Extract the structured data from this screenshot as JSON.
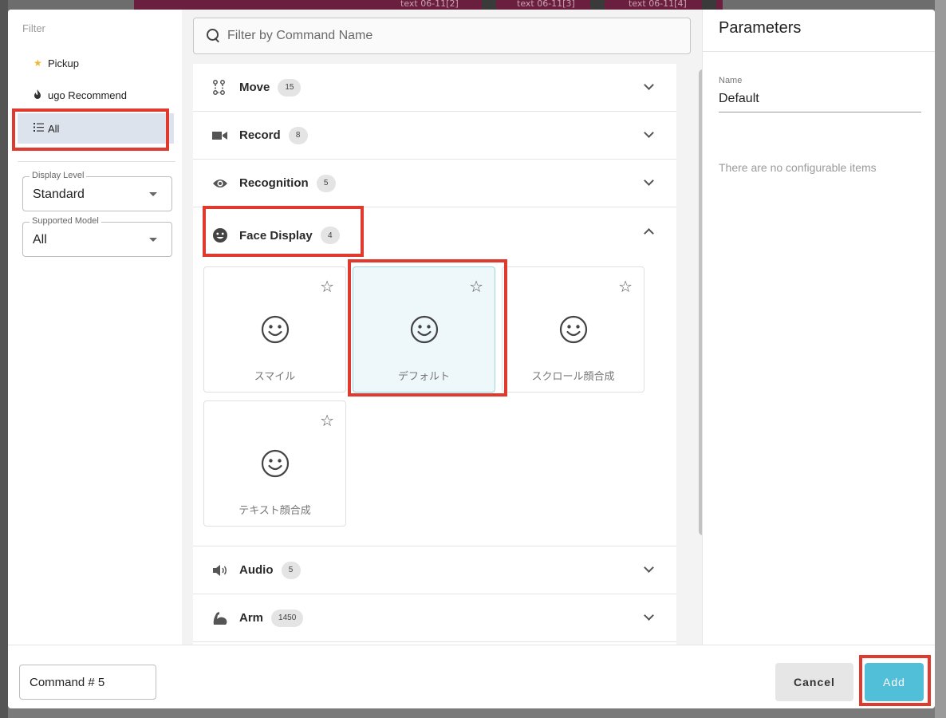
{
  "background": {
    "tabs": [
      "text 06-11[2]",
      "text 06-11[3]",
      "text 06-11[4]"
    ]
  },
  "filter": {
    "title": "Filter",
    "items": [
      {
        "label": "Pickup",
        "icon": "star-icon"
      },
      {
        "label": "ugo Recommend",
        "icon": "flame-icon"
      },
      {
        "label": "All",
        "icon": "list-icon",
        "selected": true
      }
    ],
    "display_level": {
      "legend": "Display Level",
      "value": "Standard"
    },
    "supported_model": {
      "legend": "Supported Model",
      "value": "All"
    }
  },
  "search": {
    "placeholder": "Filter by Command Name"
  },
  "categories": [
    {
      "name": "Move",
      "count": "15",
      "icon": "move-icon",
      "expanded": false
    },
    {
      "name": "Record",
      "count": "8",
      "icon": "video-camera-icon",
      "expanded": false
    },
    {
      "name": "Recognition",
      "count": "5",
      "icon": "eye-icon",
      "expanded": false
    },
    {
      "name": "Face Display",
      "count": "4",
      "icon": "smiley-icon",
      "expanded": true
    },
    {
      "name": "Audio",
      "count": "5",
      "icon": "speaker-icon",
      "expanded": false
    },
    {
      "name": "Arm",
      "count": "1450",
      "icon": "arm-icon",
      "expanded": false
    }
  ],
  "face_commands": [
    {
      "label": "スマイル",
      "selected": false
    },
    {
      "label": "デフォルト",
      "selected": true
    },
    {
      "label": "スクロール顔合成",
      "selected": false
    },
    {
      "label": "テキスト顔合成",
      "selected": false
    }
  ],
  "parameters": {
    "title": "Parameters",
    "name_label": "Name",
    "name_value": "Default",
    "empty_message": "There are no configurable items"
  },
  "footer": {
    "command_name": "Command # 5",
    "cancel_label": "Cancel",
    "add_label": "Add"
  },
  "colors": {
    "accent": "#52bfd9",
    "highlight_box": "#e03a2f",
    "selected_filter_bg": "#dde3ec",
    "pickup_star": "#f2b531"
  }
}
